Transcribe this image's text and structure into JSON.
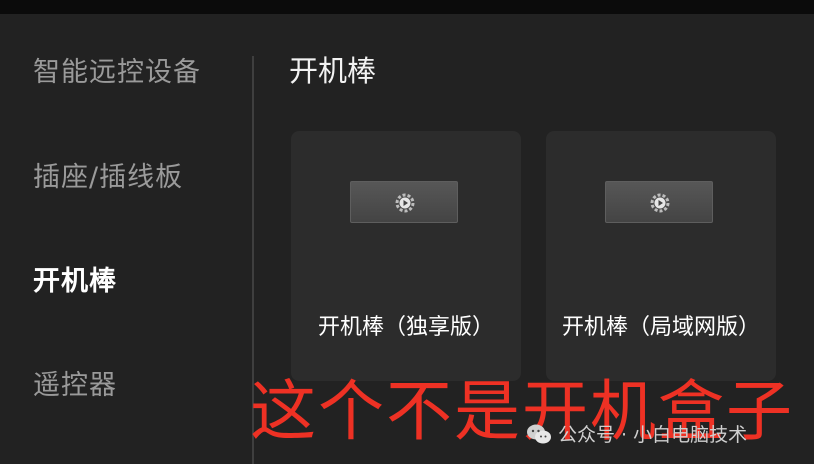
{
  "sidebar": {
    "items": [
      {
        "label": "智能远控设备"
      },
      {
        "label": "插座/插线板"
      },
      {
        "label": "开机棒"
      },
      {
        "label": "遥控器"
      }
    ]
  },
  "main": {
    "title": "开机棒",
    "cards": [
      {
        "label": "开机棒（独享版）",
        "icon": "gear-play-icon"
      },
      {
        "label": "开机棒（局域网版）",
        "icon": "gear-play-icon"
      }
    ]
  },
  "overlay": {
    "text": "这个不是开机盒子"
  },
  "watermark": {
    "text": "公众号 · 小白电脑技术",
    "icon": "wechat-icon"
  }
}
